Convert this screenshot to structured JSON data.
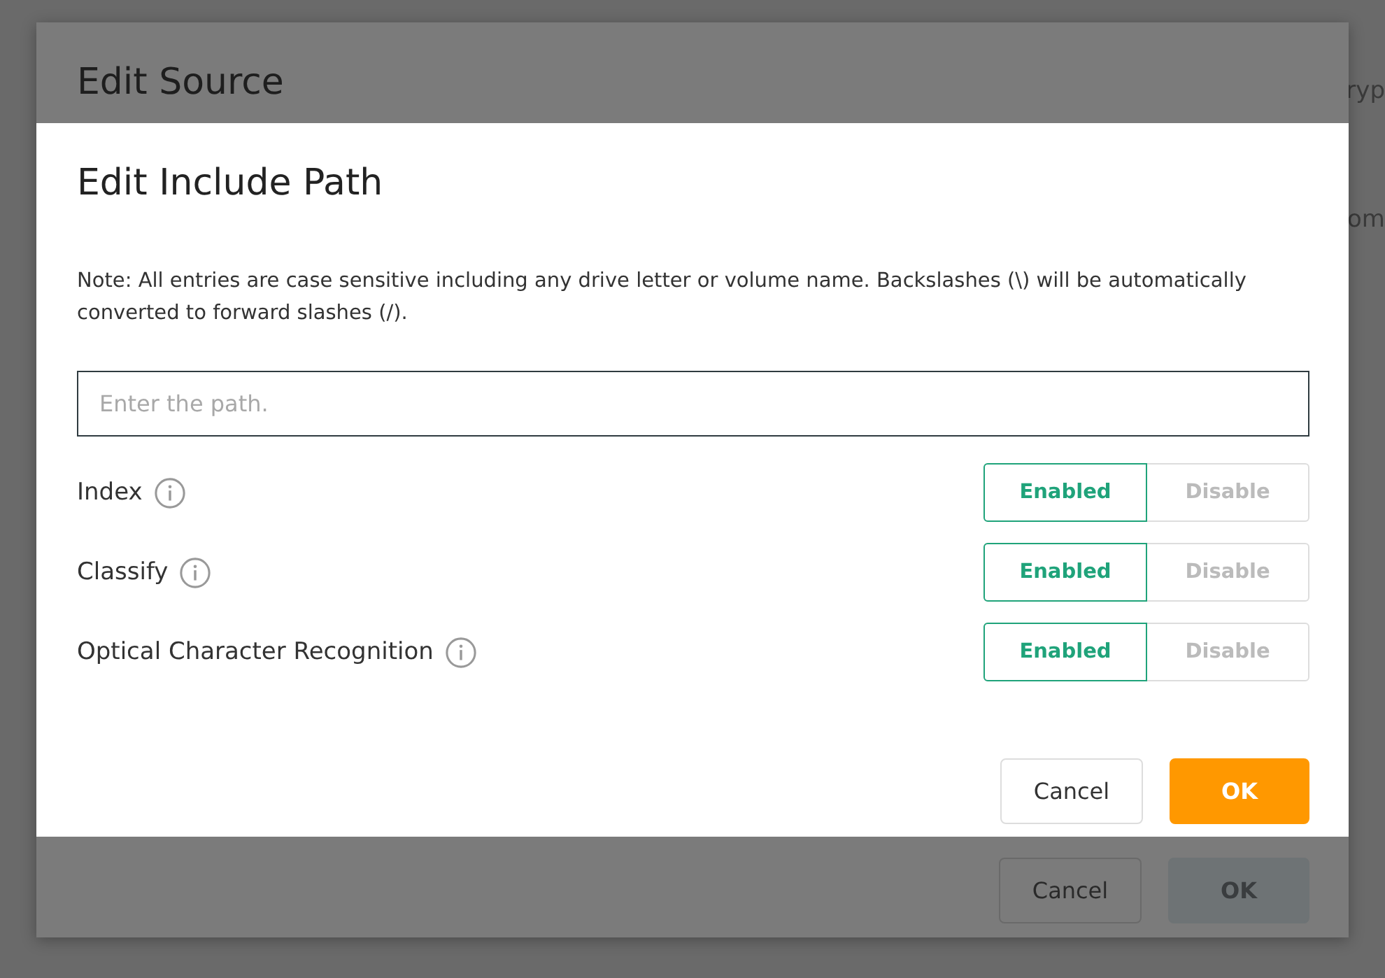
{
  "background_page": {
    "fragments": [
      "ryp",
      "om"
    ]
  },
  "outer_dialog": {
    "title": "Edit Source",
    "buttons": [
      {
        "label": "Cancel",
        "kind": "secondary"
      },
      {
        "label": "OK",
        "kind": "primary",
        "disabled": true
      }
    ]
  },
  "dialog": {
    "title": "Edit Include Path",
    "note": "Note: All entries are case sensitive including any drive letter or volume name. Backslashes (\\) will be automatically converted to forward slashes (/).",
    "path_field": {
      "placeholder": "Enter the path."
    },
    "settings": [
      {
        "label": "Index",
        "options": [
          {
            "label": "Enabled",
            "selected": true
          },
          {
            "label": "Disable",
            "selected": false
          }
        ]
      },
      {
        "label": "Classify",
        "options": [
          {
            "label": "Enabled",
            "selected": true
          },
          {
            "label": "Disable",
            "selected": false
          }
        ]
      },
      {
        "label": "Optical Character Recognition",
        "options": [
          {
            "label": "Enabled",
            "selected": true
          },
          {
            "label": "Disable",
            "selected": false
          }
        ]
      }
    ],
    "buttons": [
      {
        "label": "Cancel",
        "kind": "secondary"
      },
      {
        "label": "OK",
        "kind": "primary",
        "disabled": false
      }
    ]
  }
}
